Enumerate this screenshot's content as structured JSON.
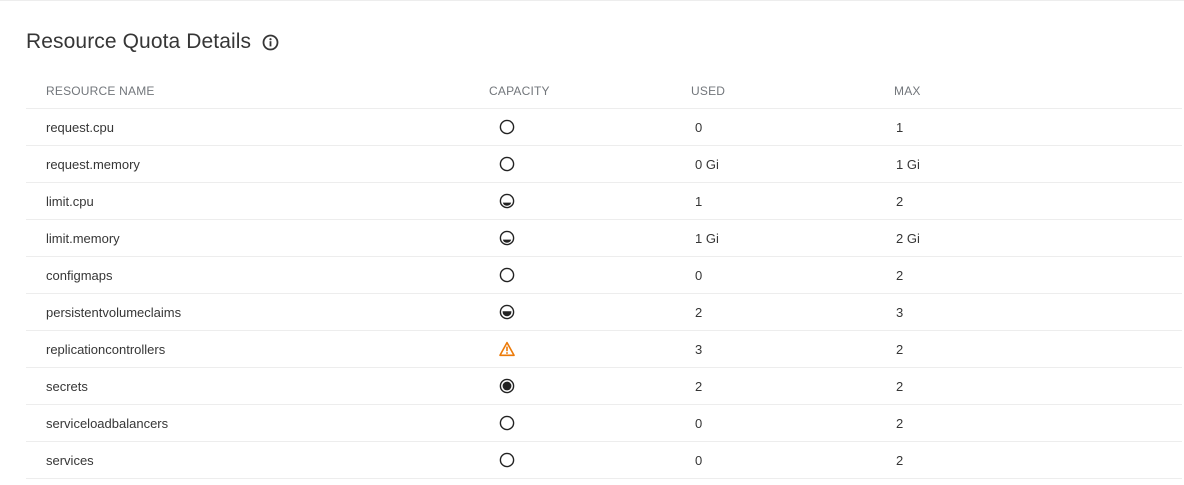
{
  "header": {
    "title": "Resource Quota Details",
    "info_icon": "info-circle-icon"
  },
  "table": {
    "columns": [
      "RESOURCE NAME",
      "CAPACITY",
      "USED",
      "MAX"
    ],
    "rows": [
      {
        "name": "request.cpu",
        "capacity": "empty",
        "used": "0",
        "max": "1"
      },
      {
        "name": "request.memory",
        "capacity": "empty",
        "used": "0 Gi",
        "max": "1 Gi"
      },
      {
        "name": "limit.cpu",
        "capacity": "half",
        "used": "1",
        "max": "2"
      },
      {
        "name": "limit.memory",
        "capacity": "half",
        "used": "1 Gi",
        "max": "2 Gi"
      },
      {
        "name": "configmaps",
        "capacity": "empty",
        "used": "0",
        "max": "2"
      },
      {
        "name": "persistentvolumeclaims",
        "capacity": "two-thirds",
        "used": "2",
        "max": "3"
      },
      {
        "name": "replicationcontrollers",
        "capacity": "warning",
        "used": "3",
        "max": "2"
      },
      {
        "name": "secrets",
        "capacity": "full",
        "used": "2",
        "max": "2"
      },
      {
        "name": "serviceloadbalancers",
        "capacity": "empty",
        "used": "0",
        "max": "2"
      },
      {
        "name": "services",
        "capacity": "empty",
        "used": "0",
        "max": "2"
      }
    ]
  },
  "colors": {
    "text": "#363636",
    "header_text": "#72767b",
    "divider": "#ededed",
    "warning": "#ec7a08"
  }
}
